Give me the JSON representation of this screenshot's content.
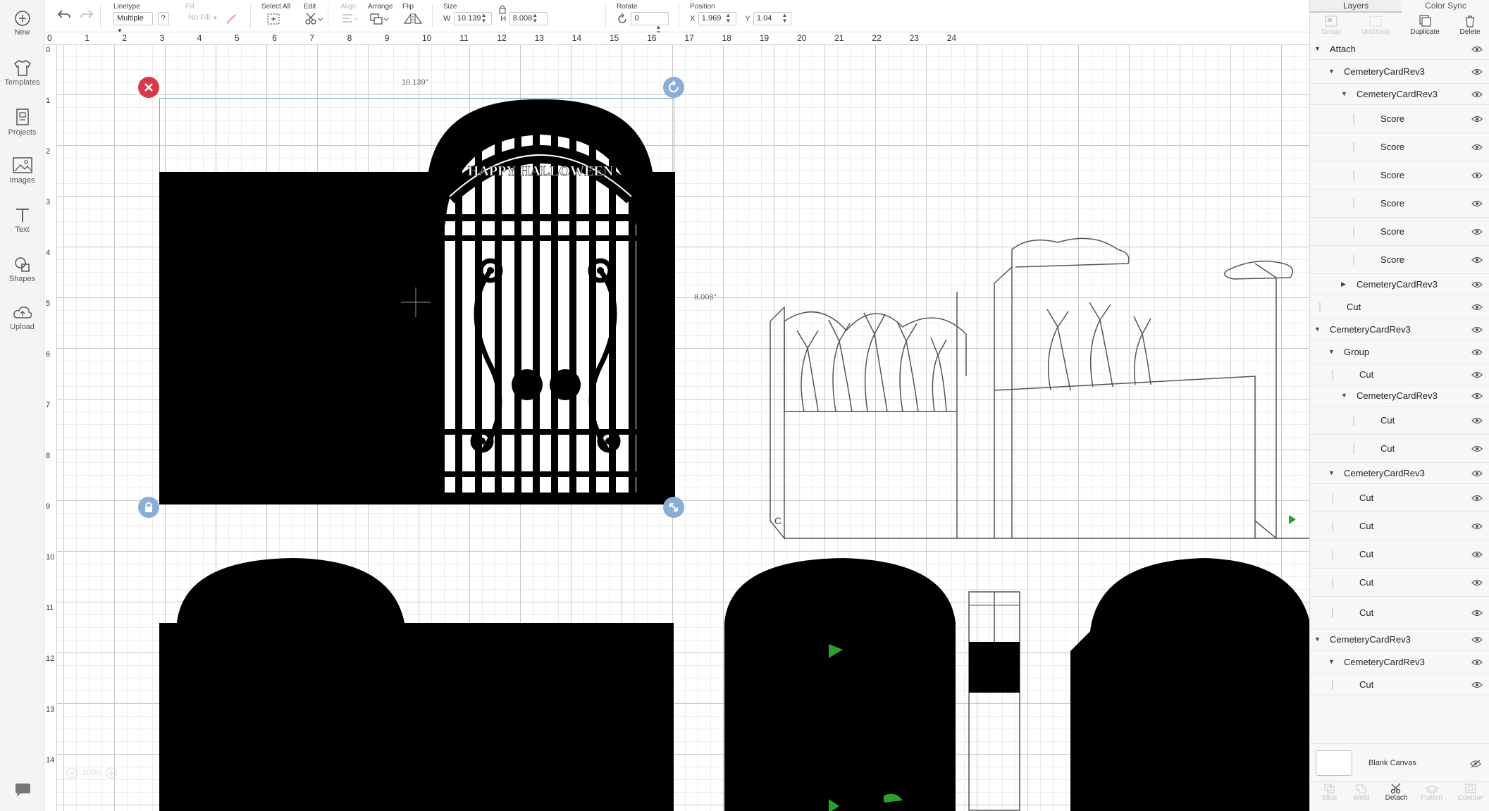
{
  "sidebar": {
    "items": [
      {
        "label": "New",
        "icon": "plus-circle-icon"
      },
      {
        "label": "Templates",
        "icon": "tshirt-icon"
      },
      {
        "label": "Projects",
        "icon": "projects-icon"
      },
      {
        "label": "Images",
        "icon": "image-icon"
      },
      {
        "label": "Text",
        "icon": "text-icon"
      },
      {
        "label": "Shapes",
        "icon": "shapes-icon"
      },
      {
        "label": "Upload",
        "icon": "upload-cloud-icon"
      }
    ]
  },
  "toolbar": {
    "linetype_label": "Linetype",
    "linetype_value": "Multiple",
    "help_label": "?",
    "fill_label": "Fill",
    "fill_value": "No Fill",
    "select_all_label": "Select All",
    "edit_label": "Edit",
    "align_label": "Align",
    "arrange_label": "Arrange",
    "flip_label": "Flip",
    "size_label": "Size",
    "w_label": "W",
    "w_value": "10.139",
    "h_label": "H",
    "h_value": "8.008",
    "rotate_label": "Rotate",
    "rotate_value": "0",
    "position_label": "Position",
    "x_label": "X",
    "x_value": "1.969",
    "y_label": "Y",
    "y_value": "1.04"
  },
  "rulers": {
    "top": [
      "0",
      "1",
      "2",
      "3",
      "4",
      "5",
      "6",
      "7",
      "8",
      "9",
      "10",
      "11",
      "12",
      "13",
      "14",
      "15",
      "16",
      "17",
      "18",
      "19",
      "20",
      "21",
      "22",
      "23",
      "24"
    ],
    "left": [
      "0",
      "1",
      "2",
      "3",
      "4",
      "5",
      "6",
      "7",
      "8",
      "9",
      "10",
      "11",
      "12",
      "13",
      "14"
    ]
  },
  "canvas": {
    "width_dimension": "10.139\"",
    "height_dimension": "8.008\"",
    "gate_banner_text": "HAPPY HALLOWEEN",
    "score_letter": "C",
    "zoom_level": "100%",
    "accent_color": "#2e9e2e",
    "selection_color": "#8aa7cc",
    "delete_handle_color": "#d9384a",
    "handle_color": "#8aaed6"
  },
  "panel": {
    "tabs": [
      "Layers",
      "Color Sync"
    ],
    "actions": [
      {
        "label": "Group",
        "enabled": false
      },
      {
        "label": "UnGroup",
        "enabled": false
      },
      {
        "label": "Duplicate",
        "enabled": true
      },
      {
        "label": "Delete",
        "enabled": true
      }
    ],
    "layers": [
      {
        "name": "Attach",
        "level": 0,
        "toggle": "open"
      },
      {
        "name": "CemeteryCardRev3",
        "level": 1,
        "toggle": "open"
      },
      {
        "name": "CemeteryCardRev3",
        "level": 2,
        "toggle": "open"
      },
      {
        "name": "Score",
        "level": 3,
        "toggle": "none"
      },
      {
        "name": "Score",
        "level": 3,
        "toggle": "none"
      },
      {
        "name": "Score",
        "level": 3,
        "toggle": "none"
      },
      {
        "name": "Score",
        "level": 3,
        "toggle": "none"
      },
      {
        "name": "Score",
        "level": 3,
        "toggle": "none"
      },
      {
        "name": "Score",
        "level": 3,
        "toggle": "none"
      },
      {
        "name": "CemeteryCardRev3",
        "level": 2,
        "toggle": "closed"
      },
      {
        "name": "Cut",
        "level": 1,
        "toggle": "none"
      },
      {
        "name": "CemeteryCardRev3",
        "level": 0,
        "toggle": "open"
      },
      {
        "name": "Group",
        "level": 1,
        "toggle": "open"
      },
      {
        "name": "Cut",
        "level": 2,
        "toggle": "none"
      },
      {
        "name": "CemeteryCardRev3",
        "level": 2,
        "toggle": "open"
      },
      {
        "name": "Cut",
        "level": 3,
        "toggle": "none"
      },
      {
        "name": "Cut",
        "level": 3,
        "toggle": "none"
      },
      {
        "name": "CemeteryCardRev3",
        "level": 1,
        "toggle": "open"
      },
      {
        "name": "Cut",
        "level": 2,
        "toggle": "none"
      },
      {
        "name": "Cut",
        "level": 2,
        "toggle": "none"
      },
      {
        "name": "Cut",
        "level": 2,
        "toggle": "none"
      },
      {
        "name": "Cut",
        "level": 2,
        "toggle": "none"
      },
      {
        "name": "Cut",
        "level": 2,
        "toggle": "none"
      },
      {
        "name": "CemeteryCardRev3",
        "level": 0,
        "toggle": "open"
      },
      {
        "name": "CemeteryCardRev3",
        "level": 1,
        "toggle": "open"
      },
      {
        "name": "Cut",
        "level": 2,
        "toggle": "none"
      }
    ],
    "blank_canvas_label": "Blank Canvas",
    "bottom_actions": [
      {
        "label": "Slice",
        "enabled": false
      },
      {
        "label": "Weld",
        "enabled": false
      },
      {
        "label": "Detach",
        "enabled": true
      },
      {
        "label": "Flatten",
        "enabled": false
      },
      {
        "label": "Contour",
        "enabled": false
      }
    ]
  }
}
